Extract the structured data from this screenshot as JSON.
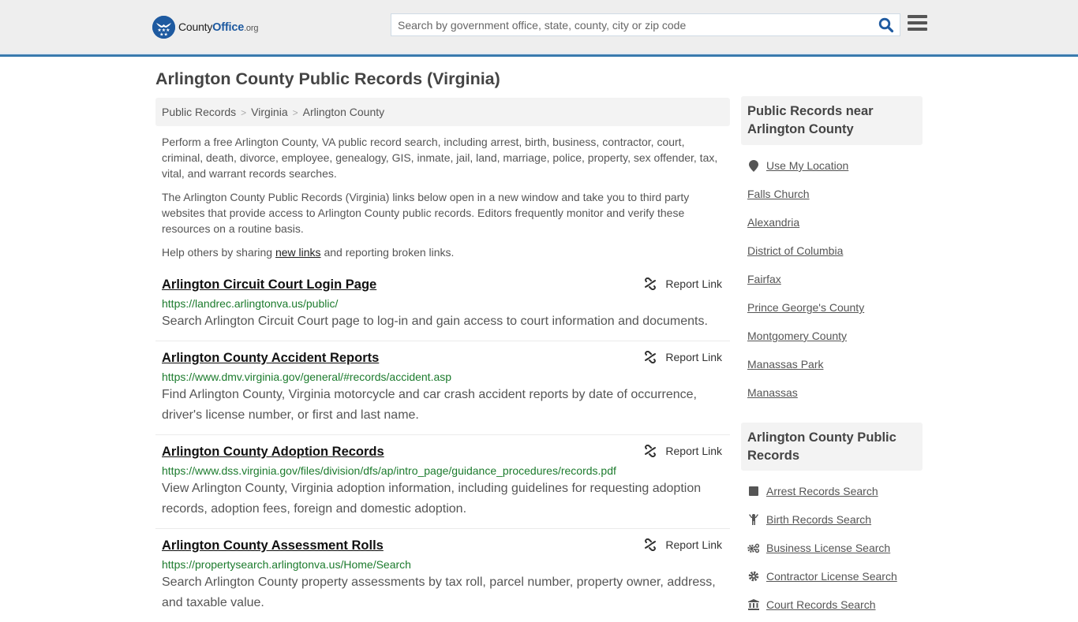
{
  "header": {
    "logo": {
      "part1": "County",
      "part2": "Office",
      "part3": ".org"
    },
    "search_placeholder": "Search by government office, state, county, city or zip code",
    "colors": {
      "brand": "#1e5aa0",
      "header_border": "#3a7bae",
      "url_green": "#1c7b2d"
    }
  },
  "page_title": "Arlington County Public Records (Virginia)",
  "breadcrumb": [
    {
      "label": "Public Records"
    },
    {
      "label": "Virginia"
    },
    {
      "label": "Arlington County"
    }
  ],
  "breadcrumb_sep": ">",
  "intro": {
    "p1": "Perform a free Arlington County, VA public record search, including arrest, birth, business, contractor, court, criminal, death, divorce, employee, genealogy, GIS, inmate, jail, land, marriage, police, property, sex offender, tax, vital, and warrant records searches.",
    "p2": "The Arlington County Public Records (Virginia) links below open in a new window and take you to third party websites that provide access to Arlington County public records. Editors frequently monitor and verify these resources on a routine basis.",
    "p3_before": "Help others by sharing ",
    "p3_link": "new links",
    "p3_after": " and reporting broken links."
  },
  "report_link_label": "Report Link",
  "records": [
    {
      "title": "Arlington Circuit Court Login Page",
      "url": "https://landrec.arlingtonva.us/public/",
      "desc": "Search Arlington Circuit Court page to log-in and gain access to court information and documents."
    },
    {
      "title": "Arlington County Accident Reports",
      "url": "https://www.dmv.virginia.gov/general/#records/accident.asp",
      "desc": "Find Arlington County, Virginia motorcycle and car crash accident reports by date of occurrence, driver's license number, or first and last name."
    },
    {
      "title": "Arlington County Adoption Records",
      "url": "https://www.dss.virginia.gov/files/division/dfs/ap/intro_page/guidance_procedures/records.pdf",
      "desc": "View Arlington County, Virginia adoption information, including guidelines for requesting adoption records, adoption fees, foreign and domestic adoption."
    },
    {
      "title": "Arlington County Assessment Rolls",
      "url": "https://propertysearch.arlingtonva.us/Home/Search",
      "desc": "Search Arlington County property assessments by tax roll, parcel number, property owner, address, and taxable value."
    }
  ],
  "sidebar": {
    "nearby_title": "Public Records near Arlington County",
    "use_location": "Use My Location",
    "nearby": [
      "Falls Church",
      "Alexandria",
      "District of Columbia",
      "Fairfax",
      "Prince George's County",
      "Montgomery County",
      "Manassas Park",
      "Manassas"
    ],
    "county_title": "Arlington County Public Records",
    "county_links": [
      {
        "label": "Arrest Records Search",
        "icon": "arrest-icon"
      },
      {
        "label": "Birth Records Search",
        "icon": "child-icon"
      },
      {
        "label": "Business License Search",
        "icon": "gears-icon"
      },
      {
        "label": "Contractor License Search",
        "icon": "gear-icon"
      },
      {
        "label": "Court Records Search",
        "icon": "courthouse-icon"
      }
    ]
  }
}
